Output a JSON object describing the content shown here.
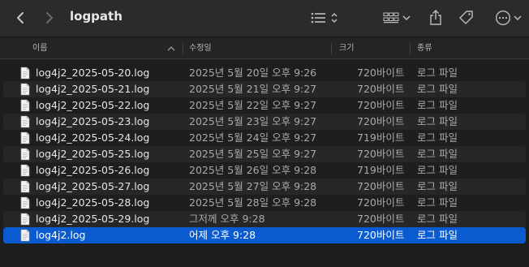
{
  "toolbar": {
    "title": "logpath",
    "icons": [
      "chevron-left-icon",
      "chevron-right-icon",
      "list-view-icon",
      "sort-chevrons-icon",
      "grid-view-icon",
      "chevron-down-icon",
      "share-icon",
      "tag-icon",
      "more-icon",
      "chevron-down-icon"
    ]
  },
  "columns": {
    "name": "이름",
    "date": "수정일",
    "size": "크기",
    "kind": "종류"
  },
  "files": [
    {
      "name": "log4j2_2025-05-20.log",
      "date": "2025년 5월 20일 오후 9:26",
      "size": "720바이트",
      "kind": "로그 파일"
    },
    {
      "name": "log4j2_2025-05-21.log",
      "date": "2025년 5월 21일 오후 9:27",
      "size": "720바이트",
      "kind": "로그 파일"
    },
    {
      "name": "log4j2_2025-05-22.log",
      "date": "2025년 5월 22일 오후 9:27",
      "size": "720바이트",
      "kind": "로그 파일"
    },
    {
      "name": "log4j2_2025-05-23.log",
      "date": "2025년 5월 23일 오후 9:27",
      "size": "720바이트",
      "kind": "로그 파일"
    },
    {
      "name": "log4j2_2025-05-24.log",
      "date": "2025년 5월 24일 오후 9:27",
      "size": "719바이트",
      "kind": "로그 파일"
    },
    {
      "name": "log4j2_2025-05-25.log",
      "date": "2025년 5월 25일 오후 9:27",
      "size": "720바이트",
      "kind": "로그 파일"
    },
    {
      "name": "log4j2_2025-05-26.log",
      "date": "2025년 5월 26일 오후 9:28",
      "size": "719바이트",
      "kind": "로그 파일"
    },
    {
      "name": "log4j2_2025-05-27.log",
      "date": "2025년 5월 27일 오후 9:28",
      "size": "720바이트",
      "kind": "로그 파일"
    },
    {
      "name": "log4j2_2025-05-28.log",
      "date": "2025년 5월 28일 오후 9:28",
      "size": "720바이트",
      "kind": "로그 파일"
    },
    {
      "name": "log4j2_2025-05-29.log",
      "date": "그저께 오후 9:28",
      "size": "720바이트",
      "kind": "로그 파일"
    },
    {
      "name": "log4j2.log",
      "date": "어제 오후 9:28",
      "size": "720바이트",
      "kind": "로그 파일",
      "selected": true
    }
  ],
  "colors": {
    "selection": "#0a5bcf",
    "background": "#1e1e1e",
    "toolbar": "#2b2b2b"
  }
}
